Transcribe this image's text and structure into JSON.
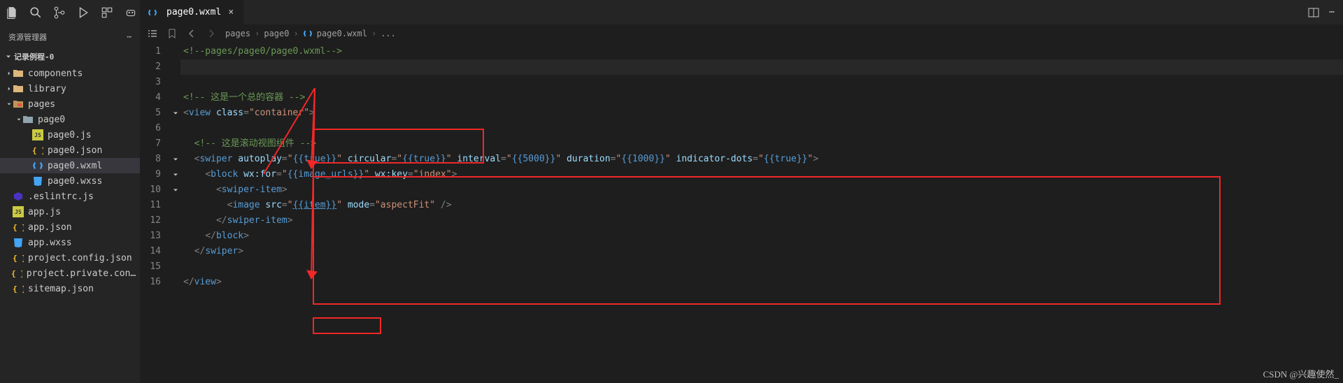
{
  "sidebar": {
    "title": "资源管理器",
    "project": "记录例程-0",
    "tree": [
      {
        "label": "components",
        "depth": 0,
        "icon": "folder-yellow",
        "twist": "right"
      },
      {
        "label": "library",
        "depth": 0,
        "icon": "folder-yellow",
        "twist": "right"
      },
      {
        "label": "pages",
        "depth": 0,
        "icon": "folder-red",
        "twist": "down"
      },
      {
        "label": "page0",
        "depth": 1,
        "icon": "folder-grey",
        "twist": "down"
      },
      {
        "label": "page0.js",
        "depth": 2,
        "icon": "js"
      },
      {
        "label": "page0.json",
        "depth": 2,
        "icon": "json"
      },
      {
        "label": "page0.wxml",
        "depth": 2,
        "icon": "wxml",
        "selected": true
      },
      {
        "label": "page0.wxss",
        "depth": 2,
        "icon": "wxss"
      },
      {
        "label": ".eslintrc.js",
        "depth": 0,
        "icon": "eslint"
      },
      {
        "label": "app.js",
        "depth": 0,
        "icon": "js"
      },
      {
        "label": "app.json",
        "depth": 0,
        "icon": "json"
      },
      {
        "label": "app.wxss",
        "depth": 0,
        "icon": "wxss"
      },
      {
        "label": "project.config.json",
        "depth": 0,
        "icon": "json"
      },
      {
        "label": "project.private.config.json",
        "depth": 0,
        "icon": "json"
      },
      {
        "label": "sitemap.json",
        "depth": 0,
        "icon": "json"
      }
    ]
  },
  "tab": {
    "file": "page0.wxml"
  },
  "breadcrumb": [
    "pages",
    "page0",
    "page0.wxml",
    "..."
  ],
  "code_lines": [
    {
      "n": 1,
      "html": "<span class='tok-com'>&lt;!--pages/page0/page0.wxml--&gt;</span>"
    },
    {
      "n": 2,
      "html": "",
      "hl": true
    },
    {
      "n": 3,
      "html": ""
    },
    {
      "n": 4,
      "html": "<span class='tok-com'>&lt;!-- 这是一个总的容器 --&gt;</span>"
    },
    {
      "n": 5,
      "fold": true,
      "html": "<span class='tok-pun'>&lt;</span><span class='tok-tag'>view</span> <span class='tok-attr'>class</span><span class='tok-pun'>=</span><span class='tok-str'>\"container\"</span><span class='tok-pun'>&gt;</span>"
    },
    {
      "n": 6,
      "html": ""
    },
    {
      "n": 7,
      "html": "  <span class='tok-com'>&lt;!-- 这是滚动视图组件 --&gt;</span>"
    },
    {
      "n": 8,
      "fold": true,
      "html": "  <span class='tok-pun'>&lt;</span><span class='tok-tag'>swiper</span> <span class='tok-attr'>autoplay</span><span class='tok-pun'>=</span><span class='tok-str'>\"</span><span class='tok-tag'>{{true}}</span><span class='tok-str'>\"</span> <span class='tok-attr'>circular</span><span class='tok-pun'>=</span><span class='tok-str'>\"</span><span class='tok-tag'>{{true}}</span><span class='tok-str'>\"</span> <span class='tok-attr'>interval</span><span class='tok-pun'>=</span><span class='tok-str'>\"</span><span class='tok-tag'>{{5000}}</span><span class='tok-str'>\"</span> <span class='tok-attr'>duration</span><span class='tok-pun'>=</span><span class='tok-str'>\"</span><span class='tok-tag'>{{1000}}</span><span class='tok-str'>\"</span> <span class='tok-attr'>indicator-dots</span><span class='tok-pun'>=</span><span class='tok-str'>\"</span><span class='tok-tag'>{{true}}</span><span class='tok-str'>\"</span><span class='tok-pun'>&gt;</span>"
    },
    {
      "n": 9,
      "fold": true,
      "html": "    <span class='tok-pun'>&lt;</span><span class='tok-tag'>block</span> <span class='tok-attr'>wx:for</span><span class='tok-pun'>=</span><span class='tok-str'>\"</span><span class='tok-tag'>{{image_urls}}</span><span class='tok-str'>\"</span> <span class='tok-attr'>wx:key</span><span class='tok-pun'>=</span><span class='tok-str'>\"index\"</span><span class='tok-pun'>&gt;</span>"
    },
    {
      "n": 10,
      "fold": true,
      "html": "      <span class='tok-pun'>&lt;</span><span class='tok-tag'>swiper-item</span><span class='tok-pun'>&gt;</span>"
    },
    {
      "n": 11,
      "html": "        <span class='tok-pun'>&lt;</span><span class='tok-tag'>image</span> <span class='tok-attr'>src</span><span class='tok-pun'>=</span><span class='tok-str'>\"</span><span class='tok-tag' style='text-decoration:underline'>{{item}}</span><span class='tok-str'>\"</span> <span class='tok-attr'>mode</span><span class='tok-pun'>=</span><span class='tok-str'>\"aspectFit\"</span> <span class='tok-pun'>/&gt;</span>"
    },
    {
      "n": 12,
      "html": "      <span class='tok-pun'>&lt;/</span><span class='tok-tag'>swiper-item</span><span class='tok-pun'>&gt;</span>"
    },
    {
      "n": 13,
      "html": "    <span class='tok-pun'>&lt;/</span><span class='tok-tag'>block</span><span class='tok-pun'>&gt;</span>"
    },
    {
      "n": 14,
      "html": "  <span class='tok-pun'>&lt;/</span><span class='tok-tag'>swiper</span><span class='tok-pun'>&gt;</span>"
    },
    {
      "n": 15,
      "html": ""
    },
    {
      "n": 16,
      "html": "<span class='tok-pun'>&lt;/</span><span class='tok-tag'>view</span><span class='tok-pun'>&gt;</span>"
    }
  ],
  "watermark": "CSDN @兴趣使然_"
}
